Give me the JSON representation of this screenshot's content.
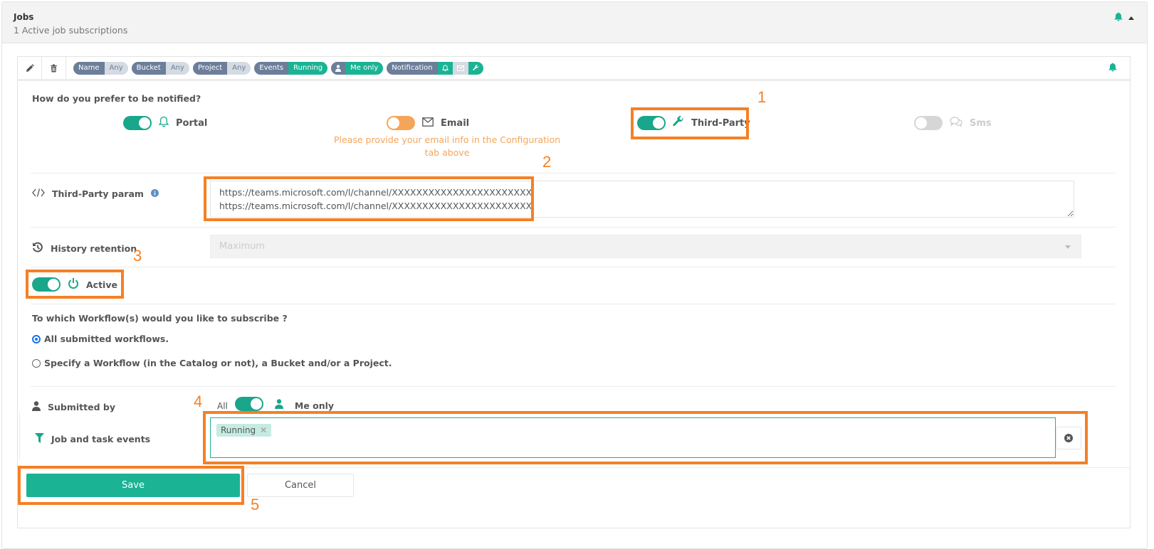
{
  "header": {
    "title": "Jobs",
    "subtitle": "1 Active job subscriptions"
  },
  "toolbar": {
    "filters": [
      {
        "key": "Name",
        "value": "Any",
        "value_style": "grey"
      },
      {
        "key": "Bucket",
        "value": "Any",
        "value_style": "grey"
      },
      {
        "key": "Project",
        "value": "Any",
        "value_style": "grey"
      },
      {
        "key": "Events",
        "value": "Running",
        "value_style": "green"
      },
      {
        "key": "user-icon",
        "value": "Me only",
        "value_style": "green"
      },
      {
        "key": "Notification",
        "value": "",
        "value_style": "icons"
      }
    ]
  },
  "notify": {
    "question": "How do you prefer to be notified?",
    "options": [
      {
        "label": "Portal",
        "icon": "bell-icon",
        "enabled": true,
        "color": "#1aa68a"
      },
      {
        "label": "Email",
        "icon": "envelope-icon",
        "enabled": true,
        "color": "#f5a55a"
      },
      {
        "label": "Third-Party",
        "icon": "wrench-icon",
        "enabled": true,
        "color": "#1aa68a"
      },
      {
        "label": "Sms",
        "icon": "comments-icon",
        "enabled": false,
        "color": "#d6d6d6"
      }
    ],
    "email_warning": "Please provide your email info in the Configuration tab above"
  },
  "third_party": {
    "label": "Third-Party param",
    "value": "https://teams.microsoft.com/l/channel/XXXXXXXXXXXXXXXXXXXXXXX\nhttps://teams.microsoft.com/l/channel/XXXXXXXXXXXXXXXXXXXXXXX"
  },
  "history": {
    "label": "History retention",
    "value": "Maximum"
  },
  "active": {
    "label": "Active",
    "on": true
  },
  "workflows": {
    "question": "To which Workflow(s) would you like to subscribe ?",
    "options": [
      {
        "label": "All submitted workflows.",
        "checked": true
      },
      {
        "label": "Specify a Workflow (in the Catalog or not), a Bucket and/or a Project.",
        "checked": false
      }
    ]
  },
  "submitted_by": {
    "label": "Submitted by",
    "left_option": "All",
    "right_option": "Me only",
    "me_only": true
  },
  "events": {
    "label": "Job and task events",
    "tags": [
      "Running"
    ]
  },
  "actions": {
    "save": "Save",
    "cancel": "Cancel"
  },
  "annotations": [
    "1",
    "2",
    "3",
    "4",
    "5"
  ],
  "colors": {
    "accent": "#1ab394",
    "warning": "#f5a55a",
    "annotation": "#f58025",
    "pill_key": "#6c7e9a"
  }
}
